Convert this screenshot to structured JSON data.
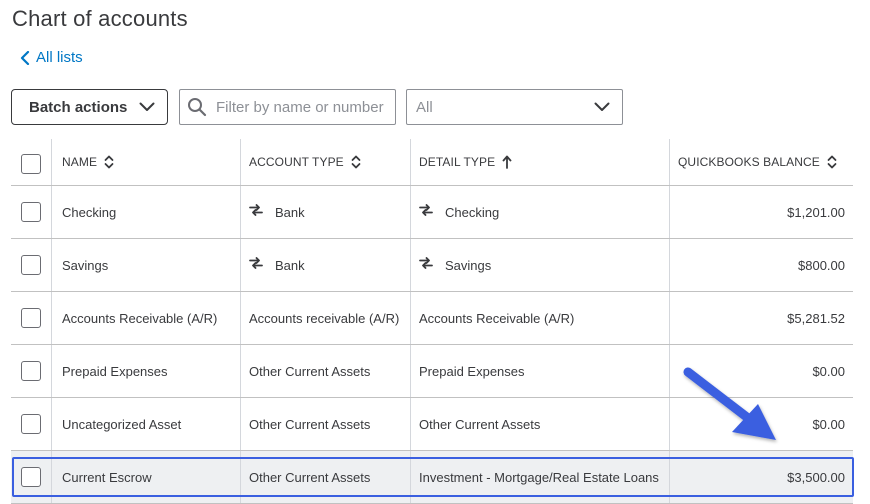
{
  "page": {
    "title": "Chart of accounts"
  },
  "nav": {
    "back_label": "All lists"
  },
  "toolbar": {
    "batch_label": "Batch actions",
    "search_placeholder": "Filter by name or number",
    "filter_value": "All"
  },
  "table": {
    "headers": {
      "name": "NAME",
      "account_type": "ACCOUNT TYPE",
      "detail_type": "DETAIL TYPE",
      "balance": "QUICKBOOKS BALANCE"
    },
    "rows": [
      {
        "name": "Checking",
        "account_type": "Bank",
        "detail_type": "Checking",
        "balance": "$1,201.00",
        "type_icon": "transfer-icon",
        "detail_icon": "transfer-icon"
      },
      {
        "name": "Savings",
        "account_type": "Bank",
        "detail_type": "Savings",
        "balance": "$800.00",
        "type_icon": "transfer-icon",
        "detail_icon": "transfer-icon"
      },
      {
        "name": "Accounts Receivable (A/R)",
        "account_type": "Accounts receivable (A/R)",
        "detail_type": "Accounts Receivable (A/R)",
        "balance": "$5,281.52"
      },
      {
        "name": "Prepaid Expenses",
        "account_type": "Other Current Assets",
        "detail_type": "Prepaid Expenses",
        "balance": "$0.00"
      },
      {
        "name": "Uncategorized Asset",
        "account_type": "Other Current Assets",
        "detail_type": "Other Current Assets",
        "balance": "$0.00"
      },
      {
        "name": "Current Escrow",
        "account_type": "Other Current Assets",
        "detail_type": "Investment - Mortgage/Real Estate Loans",
        "balance": "$3,500.00",
        "highlighted": true
      }
    ]
  },
  "colors": {
    "link": "#0077c5",
    "highlight_border": "#3a5fe0",
    "annotation_arrow": "#3a5fe0"
  },
  "icons": {
    "back": "chevron-left-icon",
    "dropdown": "chevron-down-icon",
    "search": "search-icon",
    "sort": "sort-icon",
    "sort_asc": "arrow-up-icon",
    "bank": "transfer-icon"
  }
}
